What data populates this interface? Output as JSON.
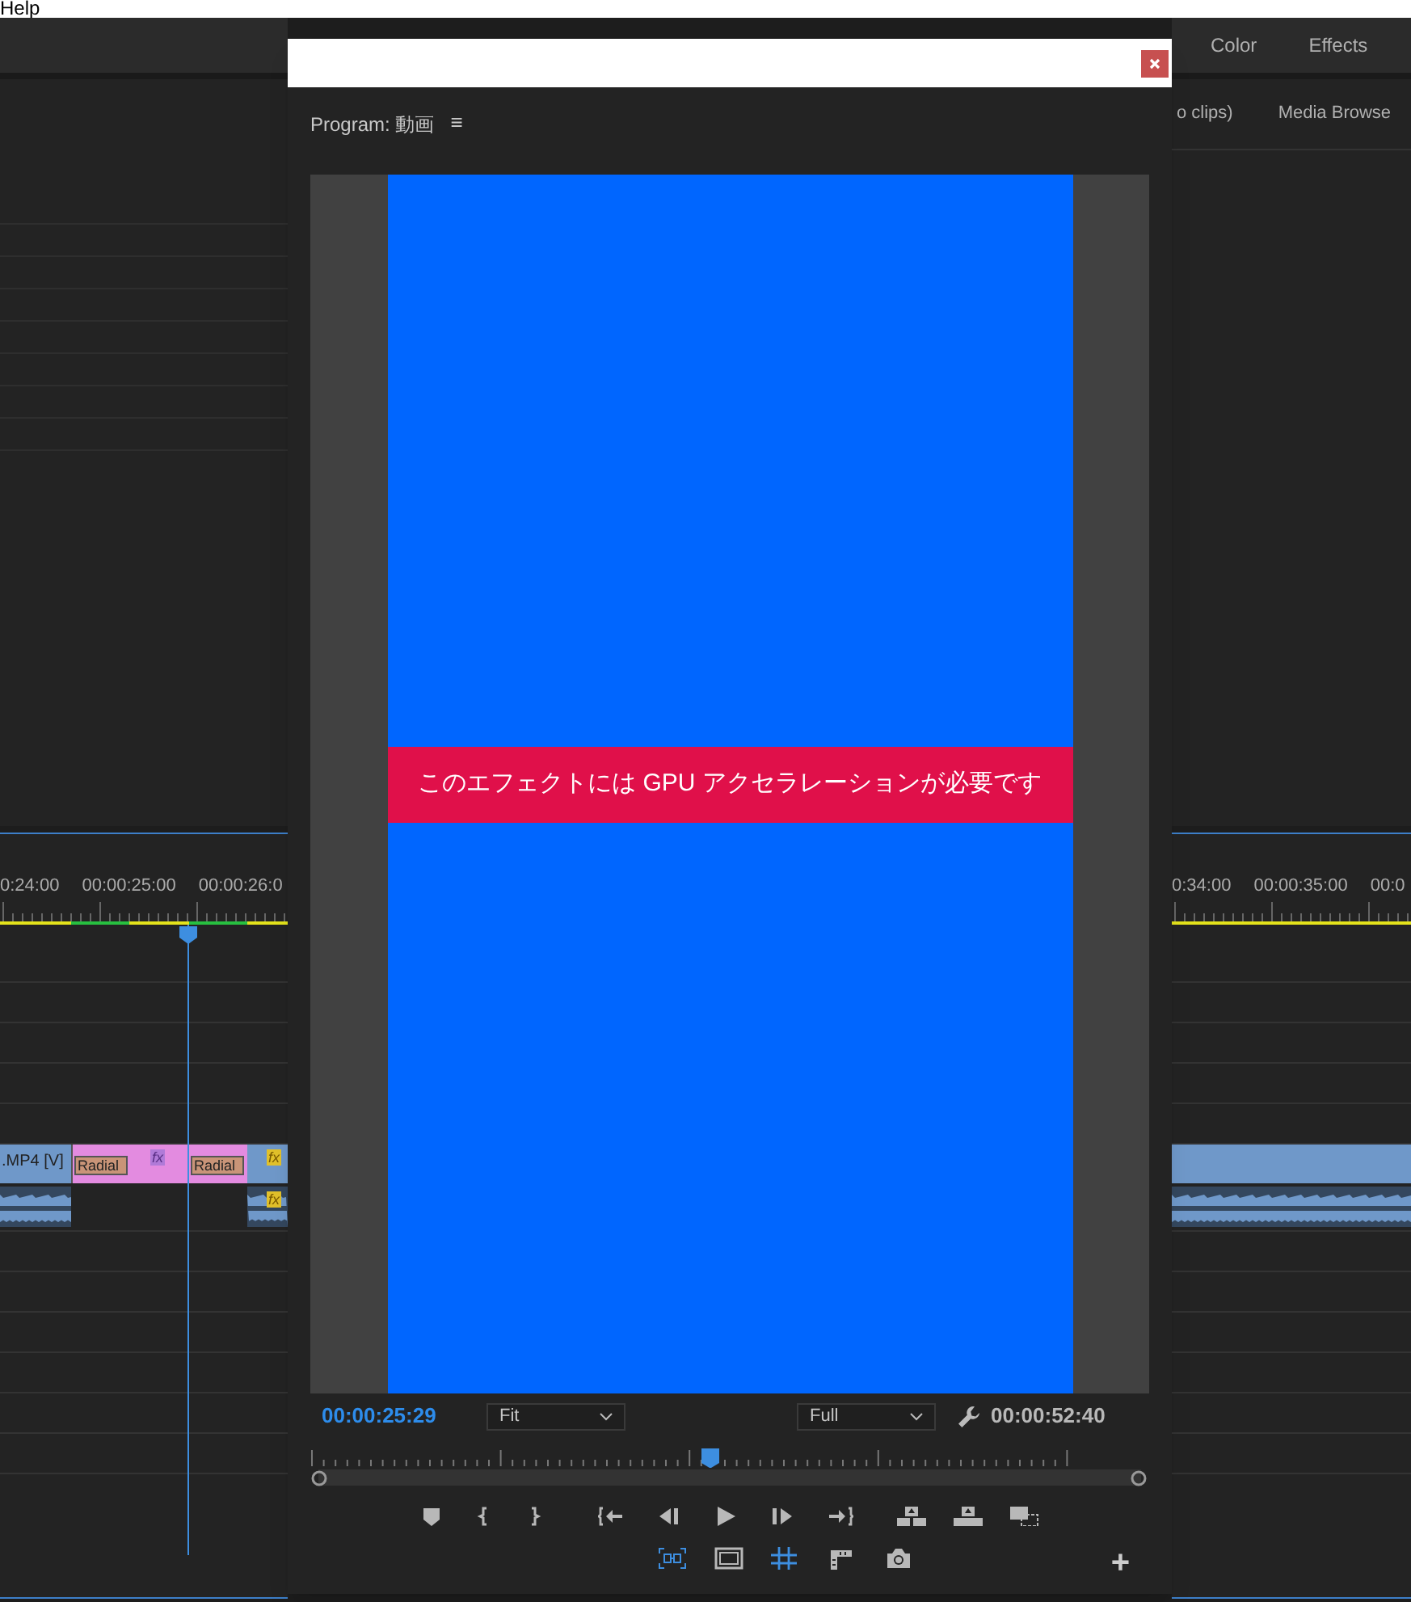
{
  "menu_bar": {
    "items": [
      "Help"
    ]
  },
  "workspace_tabs": [
    {
      "label": "Color"
    },
    {
      "label": "Effects"
    }
  ],
  "project_panel": {
    "tabs": [
      {
        "label": "o clips)"
      },
      {
        "label": "Media Browse"
      }
    ]
  },
  "timeline_left": {
    "ruler": [
      "0:24:00",
      "00:00:25:00",
      "00:00:26:0"
    ],
    "video_clips": [
      {
        "kind": "video",
        "label": ".MP4 [V]"
      },
      {
        "kind": "effect",
        "label": "Radial",
        "fx": "fx"
      },
      {
        "kind": "effect",
        "label": "Radial"
      },
      {
        "kind": "video",
        "fx": "fx"
      }
    ],
    "audio_clips": [
      {
        "kind": "audio"
      },
      {
        "kind": "gap"
      },
      {
        "kind": "audio",
        "fx": "fx"
      }
    ]
  },
  "timeline_right": {
    "ruler": [
      "0:34:00",
      "00:00:35:00",
      "00:0"
    ],
    "video_clips": [
      {
        "kind": "video"
      }
    ],
    "audio_clips": [
      {
        "kind": "audio"
      }
    ]
  },
  "program_monitor": {
    "title": "Program: 動画",
    "menu": "≡",
    "message": "このエフェクトには GPU アクセラレーションが必要です",
    "timecode": "00:00:25:29",
    "zoom": "Fit",
    "resolution": "Full",
    "duration": "00:00:52:40",
    "level": 0.476,
    "toggles": [
      {
        "on": true
      },
      {
        "on": false
      },
      {
        "on": true
      },
      {
        "on": false
      },
      {
        "on": false
      }
    ],
    "add": "+"
  }
}
